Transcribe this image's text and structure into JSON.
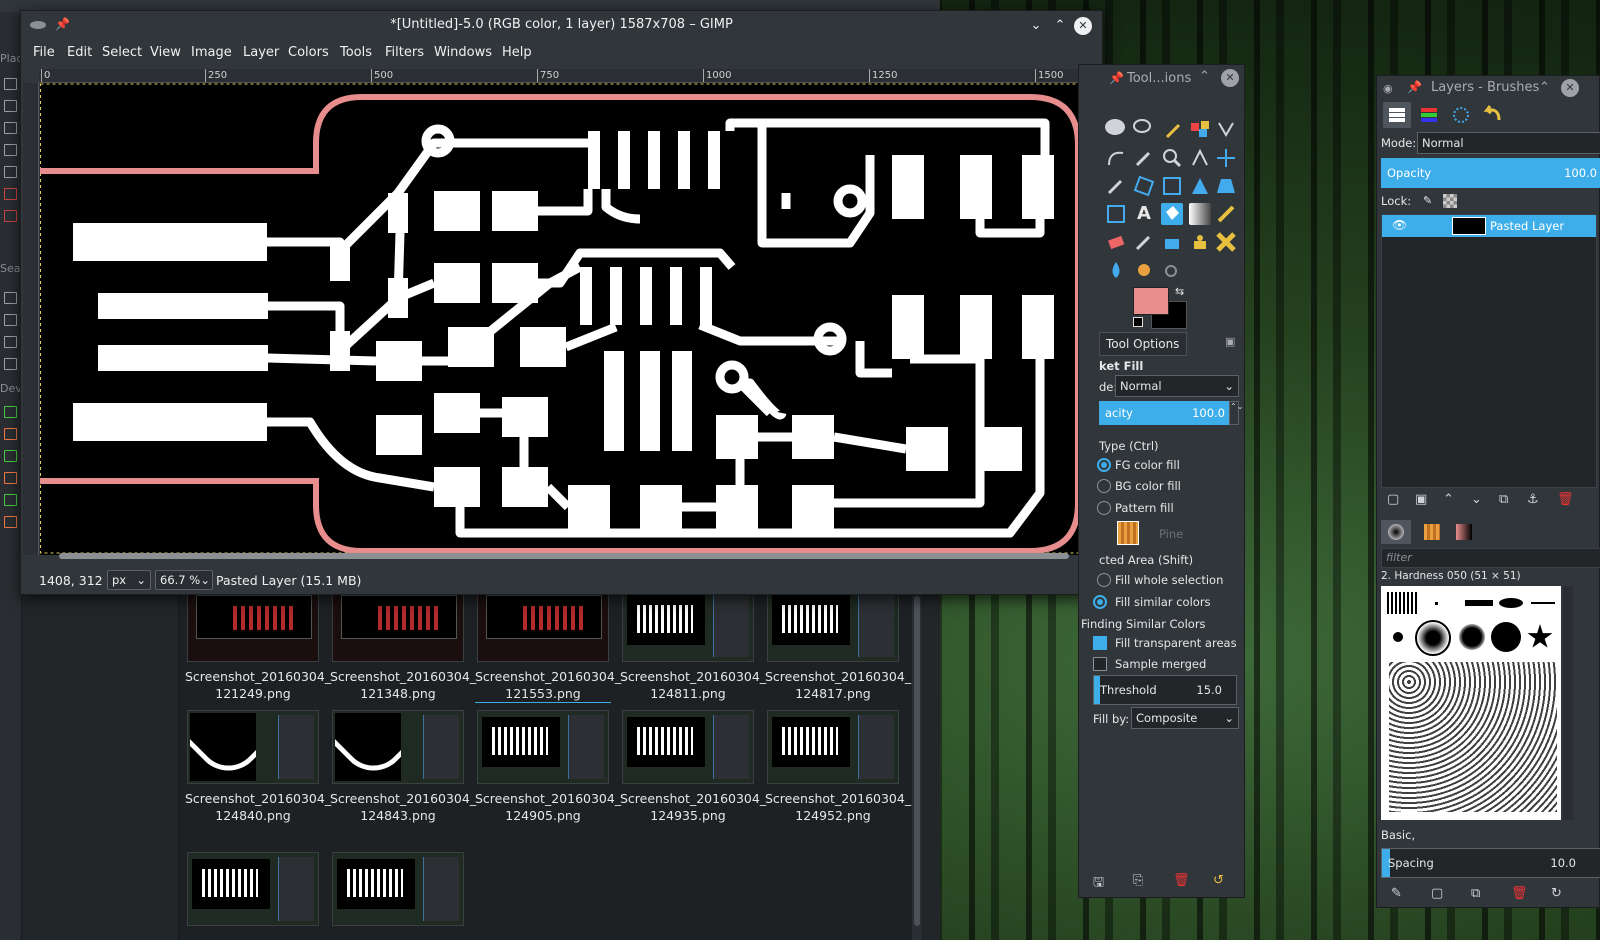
{
  "gimp": {
    "title": "*[Untitled]-5.0 (RGB color, 1 layer) 1587x708 – GIMP",
    "menu": [
      "File",
      "Edit",
      "Select",
      "View",
      "Image",
      "Layer",
      "Colors",
      "Tools",
      "Filters",
      "Windows",
      "Help"
    ],
    "ruler_ticks": [
      "0",
      "250",
      "500",
      "750",
      "1000",
      "1250",
      "1500"
    ],
    "status": {
      "coords": "1408, 312",
      "unit": "px",
      "zoom": "66.7 %",
      "layer_info": "Pasted Layer (15.1 MB)"
    }
  },
  "file_manager": {
    "places_labels": [
      "Plac",
      "Sea",
      "Dev"
    ],
    "files": [
      {
        "name_line1": "Screenshot_20160304_",
        "name_line2": "121249.png",
        "kind": "red"
      },
      {
        "name_line1": "Screenshot_20160304_",
        "name_line2": "121348.png",
        "kind": "red"
      },
      {
        "name_line1": "Screenshot_20160304_",
        "name_line2": "121553.png",
        "kind": "red"
      },
      {
        "name_line1": "Screenshot_20160304_",
        "name_line2": "124811.png",
        "kind": "gimp"
      },
      {
        "name_line1": "Screenshot_20160304_",
        "name_line2": "124817.png",
        "kind": "gimp"
      },
      {
        "name_line1": "Screenshot_20160304_",
        "name_line2": "124840.png",
        "kind": "corner"
      },
      {
        "name_line1": "Screenshot_20160304_",
        "name_line2": "124843.png",
        "kind": "corner"
      },
      {
        "name_line1": "Screenshot_20160304_",
        "name_line2": "124905.png",
        "kind": "gimp"
      },
      {
        "name_line1": "Screenshot_20160304_",
        "name_line2": "124935.png",
        "kind": "gimp"
      },
      {
        "name_line1": "Screenshot_20160304_",
        "name_line2": "124952.png",
        "kind": "gimp"
      }
    ]
  },
  "toolbox": {
    "title": "Tool...ions",
    "fg_color": "#e88d8d",
    "bg_color": "#000000",
    "options_tab": "Tool Options",
    "tool_name": "ket Fill",
    "mode_label": "de:",
    "mode_value": "Normal",
    "opacity_label": "acity",
    "opacity_value": "100.0",
    "fill_type_label": "Type  (Ctrl)",
    "fill_types": [
      "FG color fill",
      "BG color fill",
      "Pattern fill"
    ],
    "pattern_name": "Pine",
    "affected_label": "cted Area  (Shift)",
    "affected": [
      "Fill whole selection",
      "Fill similar colors"
    ],
    "finding_label": "Finding Similar Colors",
    "fill_transparent": "Fill transparent areas",
    "sample_merged": "Sample merged",
    "threshold_label": "Threshold",
    "threshold_value": "15.0",
    "fill_by_label": "Fill by:",
    "fill_by_value": "Composite"
  },
  "layers": {
    "title": "Layers - Brushes",
    "mode_label": "Mode:",
    "mode_value": "Normal",
    "opacity_label": "Opacity",
    "opacity_value": "100.0",
    "lock_label": "Lock:",
    "layer_name": "Pasted Layer",
    "filter_placeholder": "filter",
    "brush_name": "2. Hardness 050 (51 × 51)",
    "brush_tag": "Basic,",
    "spacing_label": "Spacing",
    "spacing_value": "10.0"
  },
  "colors": {
    "accent": "#3daee9",
    "outline": "#e88d8d",
    "window_bg": "#31363b"
  }
}
